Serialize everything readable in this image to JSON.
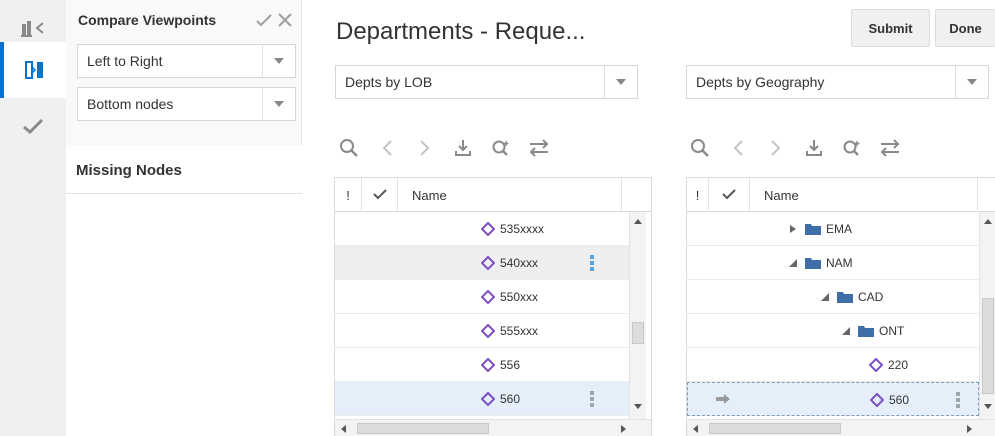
{
  "rail": {
    "items": [
      {
        "name": "hierarchy-collapse-icon"
      },
      {
        "name": "compare-viewpoints-icon",
        "active": true
      },
      {
        "name": "checkmark-icon"
      }
    ]
  },
  "compare_panel": {
    "title": "Compare Viewpoints",
    "direction_select": "Left to Right",
    "nodes_select": "Bottom nodes",
    "missing_nodes_label": "Missing Nodes"
  },
  "header": {
    "title": "Departments - Reque...",
    "submit_label": "Submit",
    "done_label": "Done"
  },
  "left_viewpoint": {
    "select": "Depts by LOB",
    "column_flag": "!",
    "column_name": "Name",
    "rows": [
      {
        "label": "535xxxx"
      },
      {
        "label": "540xxx"
      },
      {
        "label": "550xxx"
      },
      {
        "label": "555xxx"
      },
      {
        "label": "556"
      },
      {
        "label": "560"
      }
    ]
  },
  "right_viewpoint": {
    "select": "Depts by Geography",
    "column_flag": "!",
    "column_name": "Name",
    "rows": [
      {
        "label": "EMA",
        "expand": "collapsed"
      },
      {
        "label": "NAM",
        "expand": "expanded"
      },
      {
        "label": "CAD",
        "expand": "expanded"
      },
      {
        "label": "ONT",
        "expand": "expanded"
      },
      {
        "label": "220"
      },
      {
        "label": "560"
      }
    ]
  },
  "colors": {
    "accent": "#0572ce",
    "node_diamond": "#7b4fc9",
    "folder": "#3d6ea8",
    "toolbar_icon": "#8a8a8a"
  }
}
